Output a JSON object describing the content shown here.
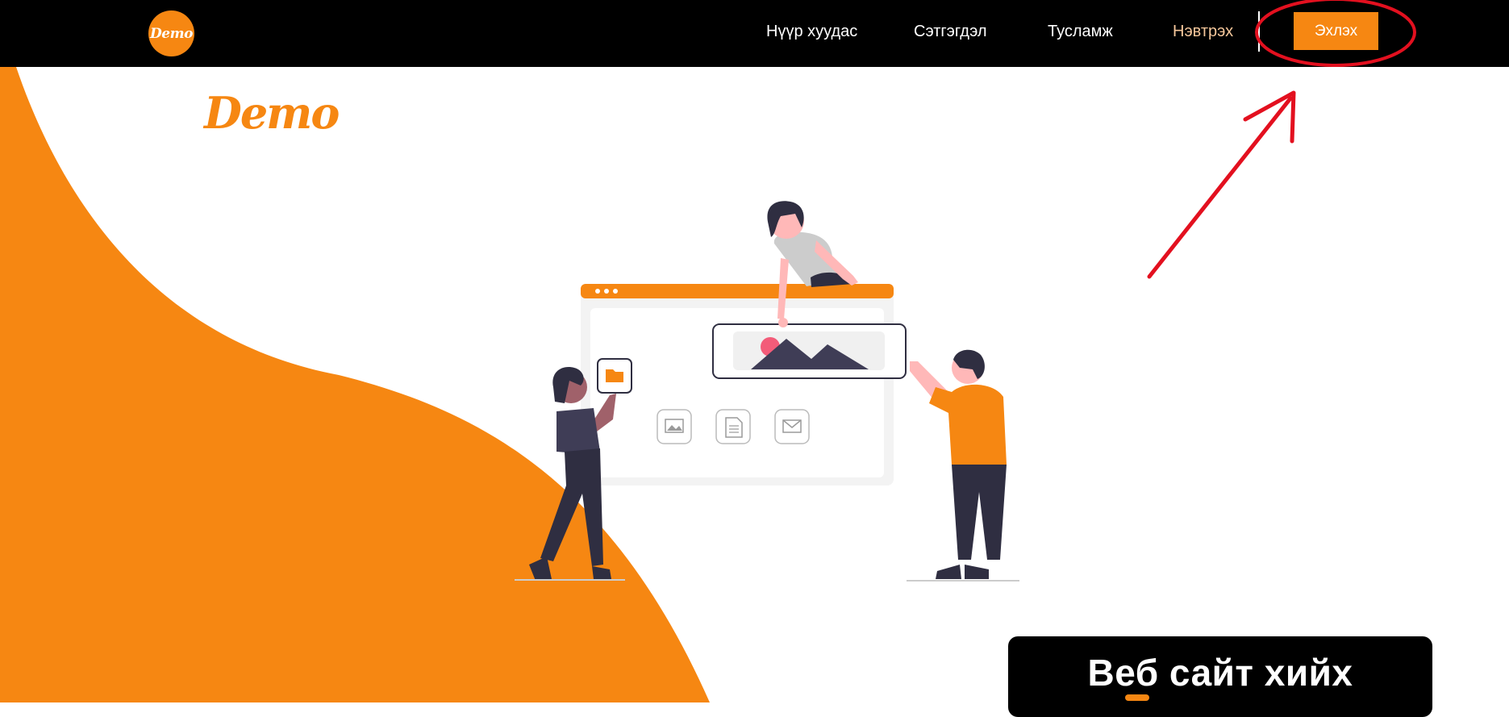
{
  "navbar": {
    "logo_text": "Demo",
    "links": [
      {
        "label": "Нүүр хуудас"
      },
      {
        "label": "Сэтгэгдэл"
      },
      {
        "label": "Тусламж"
      },
      {
        "label": "Нэвтрэх"
      }
    ],
    "start_button": "Эхлэх"
  },
  "hero": {
    "brand": "Demo",
    "headline": "Веб сайт хийх"
  },
  "colors": {
    "accent": "#f68712",
    "nav_bg": "#000000",
    "login_link": "#f6c79b",
    "annotation": "#e3101f"
  },
  "icons": [
    "folder-icon",
    "image-icon",
    "document-icon",
    "mail-icon",
    "landscape-icon"
  ]
}
